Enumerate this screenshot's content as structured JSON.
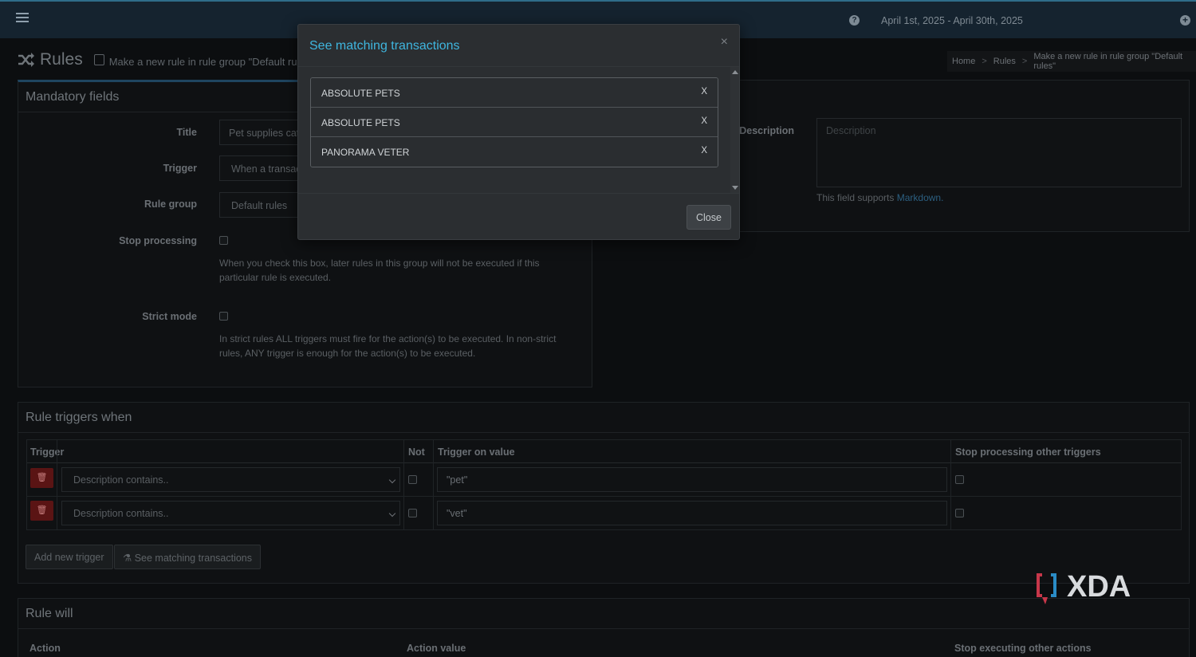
{
  "topbar": {
    "daterange": "April 1st, 2025 - April 30th, 2025",
    "icons": [
      "hamburger-icon",
      "question-circle-icon",
      "plus-circle-icon"
    ]
  },
  "header": {
    "title": "Rules",
    "subtitle": "Make a new rule in rule group \"Default rules\""
  },
  "breadcrumb": {
    "items": [
      "Home",
      "Rules",
      "Make a new rule in rule group \"Default rules\""
    ],
    "separator": ">"
  },
  "mandatory": {
    "heading": "Mandatory fields",
    "title_label": "Title",
    "title_value": "Pet supplies cat",
    "trigger_label": "Trigger",
    "trigger_value": "When a transac",
    "rule_group_label": "Rule group",
    "rule_group_value": "Default rules",
    "stop_processing_label": "Stop processing",
    "stop_processing_help": "When you check this box, later rules in this group will not be executed if this particular rule is executed.",
    "strict_mode_label": "Strict mode",
    "strict_mode_help": "In strict rules ALL triggers must fire for the action(s) to be executed. In non-strict rules, ANY trigger is enough for the action(s) to be executed."
  },
  "optional": {
    "description_label": "Description",
    "description_placeholder": "Description",
    "markdown_help": "This field supports",
    "markdown_link": "Markdown."
  },
  "triggers": {
    "heading": "Rule triggers when",
    "columns": [
      "Trigger",
      "Not",
      "Trigger on value",
      "Stop processing other triggers"
    ],
    "rows": [
      {
        "trigger": "Description contains..",
        "value": "\"pet\""
      },
      {
        "trigger": "Description contains..",
        "value": "\"vet\""
      }
    ],
    "add_button": "Add new trigger",
    "see_button": "See matching transactions"
  },
  "actions": {
    "heading": "Rule will",
    "columns": [
      "Action",
      "Action value",
      "Stop executing other actions"
    ]
  },
  "modal": {
    "title": "See matching transactions",
    "close_x": "×",
    "transactions": [
      {
        "name": "ABSOLUTE PETS",
        "remove": "X"
      },
      {
        "name": "ABSOLUTE PETS",
        "remove": "X"
      },
      {
        "name": "PANORAMA VETER",
        "remove": "X"
      }
    ],
    "close_button": "Close"
  },
  "watermark": {
    "text": "XDA"
  },
  "colors": {
    "topbar": "#15232f",
    "modal_title": "#3fb6df",
    "delete_button": "#5a1414",
    "link": "#2c5f80"
  }
}
